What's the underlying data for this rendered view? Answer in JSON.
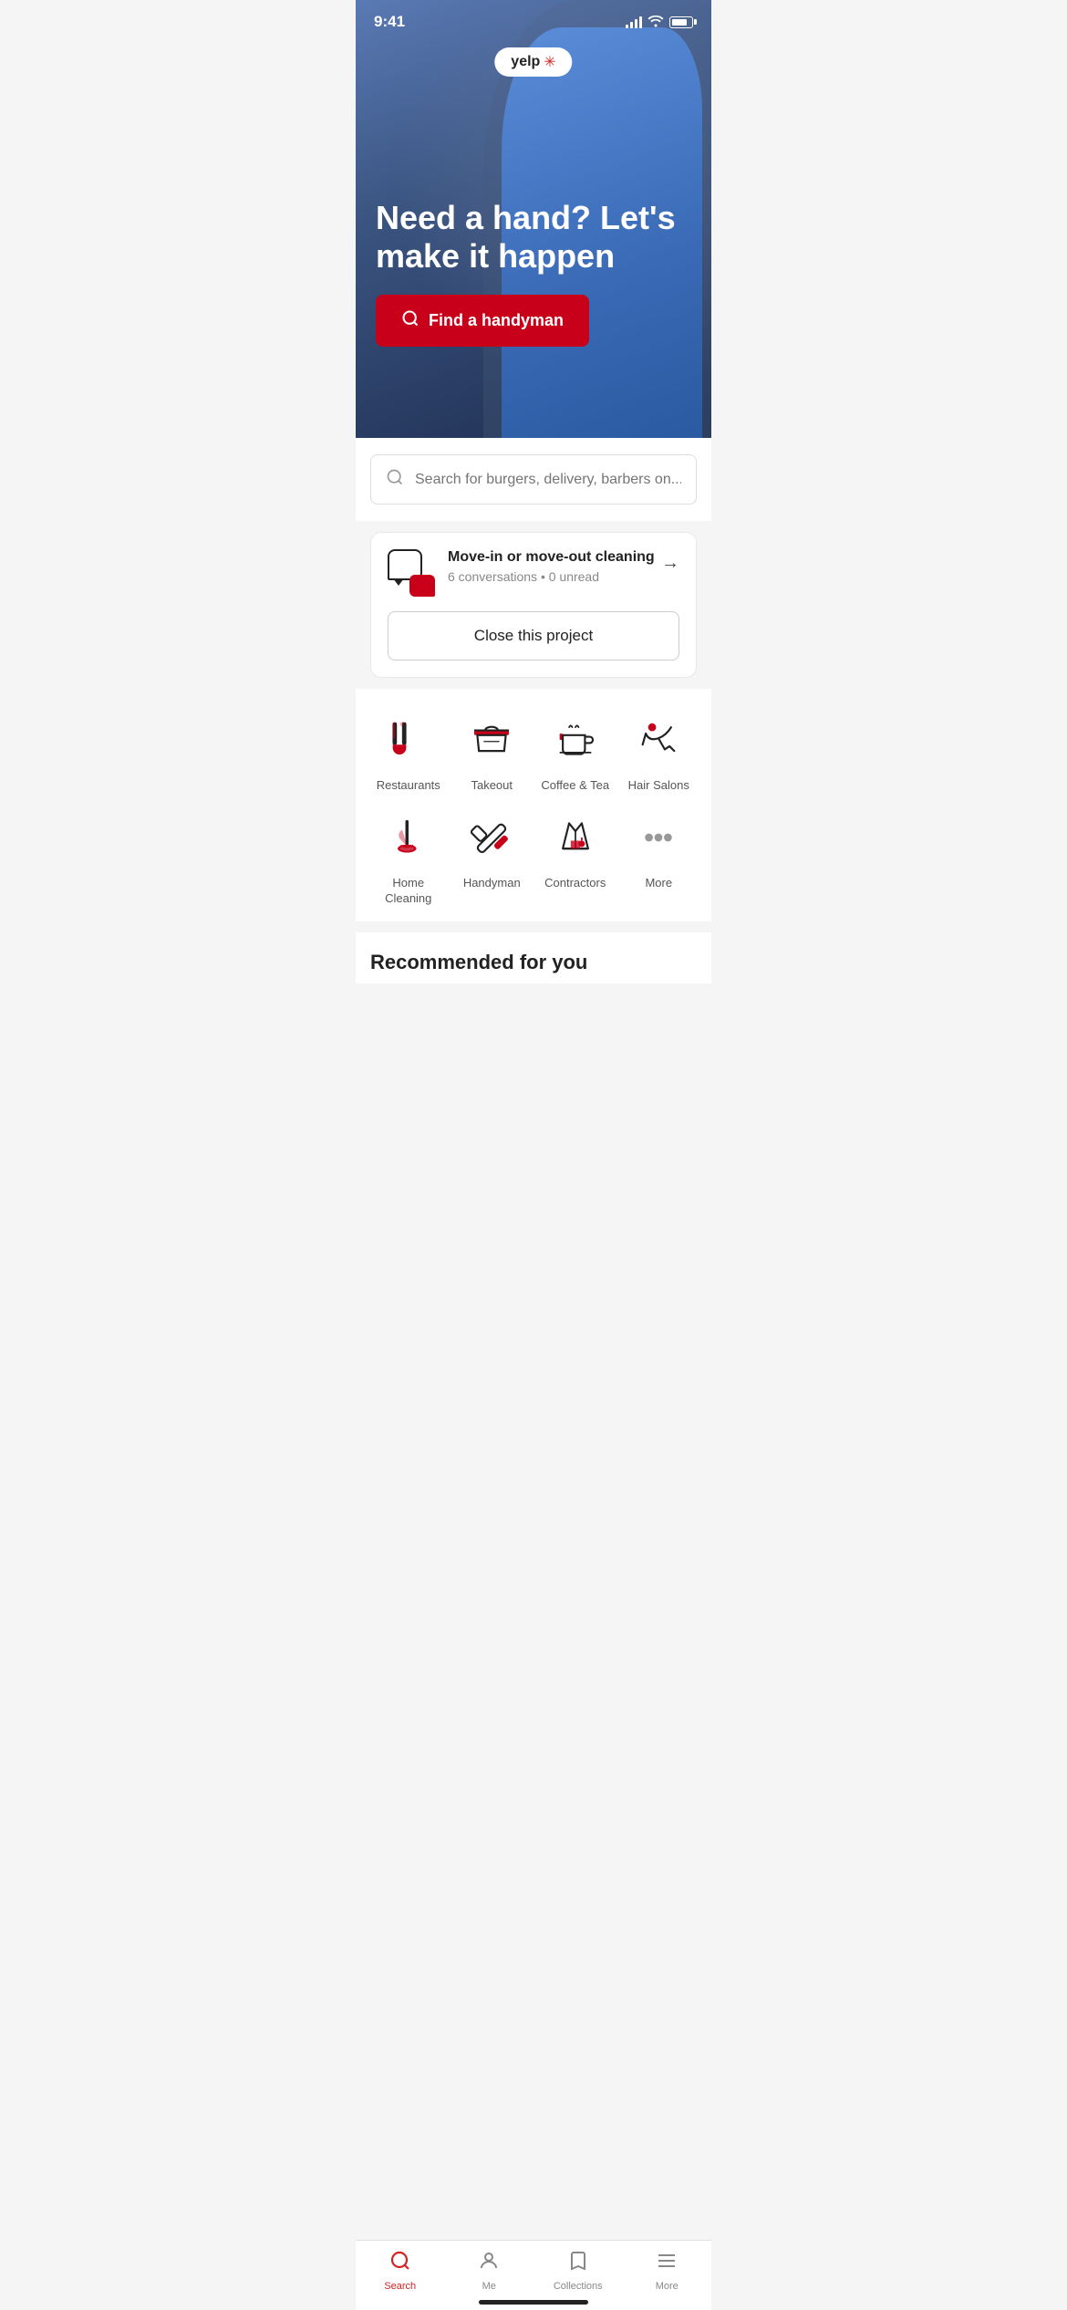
{
  "status_bar": {
    "time": "9:41"
  },
  "yelp": {
    "logo_text": "yelp",
    "burst_symbol": "✳"
  },
  "hero": {
    "title": "Need a hand? Let's make it happen",
    "cta_label": "Find a handyman",
    "cta_icon": "🔍"
  },
  "search": {
    "placeholder": "Search for burgers, delivery, barbers on..."
  },
  "project_card": {
    "title": "Move-in or move-out cleaning",
    "conversations": "6 conversations • 0 unread",
    "close_label": "Close this project"
  },
  "categories": {
    "row1": [
      {
        "id": "restaurants",
        "label": "Restaurants"
      },
      {
        "id": "takeout",
        "label": "Takeout"
      },
      {
        "id": "coffee-tea",
        "label": "Coffee & Tea"
      },
      {
        "id": "hair-salons",
        "label": "Hair Salons"
      }
    ],
    "row2": [
      {
        "id": "home-cleaning",
        "label": "Home Cleaning"
      },
      {
        "id": "handyman",
        "label": "Handyman"
      },
      {
        "id": "contractors",
        "label": "Contractors"
      },
      {
        "id": "more",
        "label": "More"
      }
    ]
  },
  "recommended": {
    "title": "Recommended for you"
  },
  "tab_bar": {
    "items": [
      {
        "id": "search",
        "label": "Search",
        "active": true
      },
      {
        "id": "me",
        "label": "Me",
        "active": false
      },
      {
        "id": "collections",
        "label": "Collections",
        "active": false
      },
      {
        "id": "more",
        "label": "More",
        "active": false
      }
    ]
  }
}
